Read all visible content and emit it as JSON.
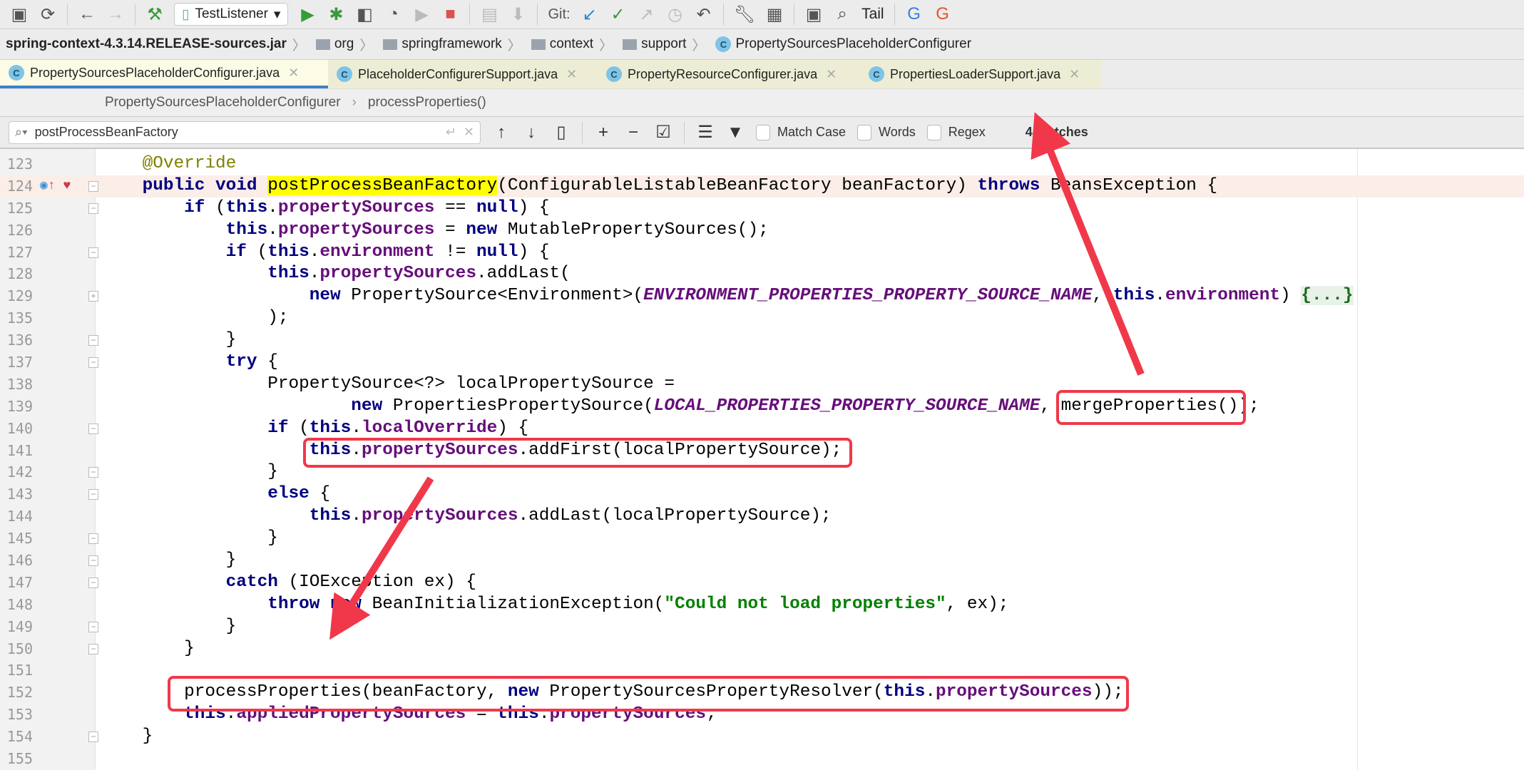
{
  "toolbar": {
    "run_config": "TestListener",
    "git_label": "Git:",
    "tail_label": "Tail"
  },
  "navbar": {
    "crumbs": [
      "spring-context-4.3.14.RELEASE-sources.jar",
      "org",
      "springframework",
      "context",
      "support",
      "PropertySourcesPlaceholderConfigurer"
    ]
  },
  "tabs": [
    {
      "label": "PropertySourcesPlaceholderConfigurer.java",
      "active": true
    },
    {
      "label": "PlaceholderConfigurerSupport.java"
    },
    {
      "label": "PropertyResourceConfigurer.java"
    },
    {
      "label": "PropertiesLoaderSupport.java"
    }
  ],
  "structure": {
    "class": "PropertySourcesPlaceholderConfigurer",
    "method": "processProperties()"
  },
  "search": {
    "value": "postProcessBeanFactory",
    "match_case": "Match Case",
    "words": "Words",
    "regex": "Regex",
    "matches": "4 matches"
  },
  "annotation_color": "#f0384a",
  "code": [
    {
      "n": "123",
      "i": 4,
      "t": [
        [
          "ann",
          "@Override"
        ]
      ]
    },
    {
      "n": "124",
      "i": 4,
      "hl": true,
      "fold": "-",
      "t": [
        [
          "kw",
          "public void "
        ],
        [
          "hly",
          "postProcessBeanFactory"
        ],
        [
          "",
          "(ConfigurableListableBeanFactory beanFactory) "
        ],
        [
          "kw",
          "throws"
        ],
        [
          "",
          " BeansException {"
        ]
      ]
    },
    {
      "n": "125",
      "i": 8,
      "fold": "-",
      "t": [
        [
          "kw",
          "if"
        ],
        [
          "",
          " ("
        ],
        [
          "kw",
          "this"
        ],
        [
          "",
          "."
        ],
        [
          "fld",
          "propertySources"
        ],
        [
          "",
          " == "
        ],
        [
          "kw",
          "null"
        ],
        [
          "",
          ") {"
        ]
      ]
    },
    {
      "n": "126",
      "i": 12,
      "t": [
        [
          "kw",
          "this"
        ],
        [
          "",
          "."
        ],
        [
          "fld",
          "propertySources"
        ],
        [
          "",
          " = "
        ],
        [
          "kw",
          "new"
        ],
        [
          "",
          " MutablePropertySources();"
        ]
      ]
    },
    {
      "n": "127",
      "i": 12,
      "fold": "-",
      "t": [
        [
          "kw",
          "if"
        ],
        [
          "",
          " ("
        ],
        [
          "kw",
          "this"
        ],
        [
          "",
          "."
        ],
        [
          "fld",
          "environment"
        ],
        [
          "",
          " != "
        ],
        [
          "kw",
          "null"
        ],
        [
          "",
          ") {"
        ]
      ]
    },
    {
      "n": "128",
      "i": 16,
      "t": [
        [
          "kw",
          "this"
        ],
        [
          "",
          "."
        ],
        [
          "fld",
          "propertySources"
        ],
        [
          "",
          ".addLast("
        ]
      ]
    },
    {
      "n": "129",
      "i": 20,
      "fold": "+",
      "t": [
        [
          "kw",
          "new"
        ],
        [
          "",
          " PropertySource<Environment>("
        ],
        [
          "cst",
          "ENVIRONMENT_PROPERTIES_PROPERTY_SOURCE_NAME"
        ],
        [
          "",
          ", "
        ],
        [
          "kw",
          "this"
        ],
        [
          "",
          "."
        ],
        [
          "fld",
          "environment"
        ],
        [
          "",
          ") "
        ],
        [
          "fd",
          "{...}"
        ]
      ]
    },
    {
      "n": "135",
      "i": 16,
      "t": [
        [
          "",
          ");"
        ]
      ]
    },
    {
      "n": "136",
      "i": 12,
      "fold": "-",
      "t": [
        [
          "",
          "}"
        ]
      ]
    },
    {
      "n": "137",
      "i": 12,
      "fold": "-",
      "t": [
        [
          "kw",
          "try"
        ],
        [
          "",
          " {"
        ]
      ]
    },
    {
      "n": "138",
      "i": 16,
      "t": [
        [
          "",
          "PropertySource<?> localPropertySource ="
        ]
      ]
    },
    {
      "n": "139",
      "i": 24,
      "t": [
        [
          "kw",
          "new"
        ],
        [
          "",
          " PropertiesPropertySource("
        ],
        [
          "cst",
          "LOCAL_PROPERTIES_PROPERTY_SOURCE_NAME"
        ],
        [
          "",
          ", mergeProperties());"
        ]
      ]
    },
    {
      "n": "140",
      "i": 16,
      "fold": "-",
      "t": [
        [
          "kw",
          "if"
        ],
        [
          "",
          " ("
        ],
        [
          "kw",
          "this"
        ],
        [
          "",
          "."
        ],
        [
          "fld",
          "localOverride"
        ],
        [
          "",
          ") {"
        ]
      ]
    },
    {
      "n": "141",
      "i": 20,
      "t": [
        [
          "kw",
          "this"
        ],
        [
          "",
          "."
        ],
        [
          "fld",
          "propertySources"
        ],
        [
          "",
          ".addFirst(localPropertySource);"
        ]
      ]
    },
    {
      "n": "142",
      "i": 16,
      "fold": "-",
      "t": [
        [
          "",
          "}"
        ]
      ]
    },
    {
      "n": "143",
      "i": 16,
      "fold": "-",
      "t": [
        [
          "kw",
          "else"
        ],
        [
          "",
          " {"
        ]
      ]
    },
    {
      "n": "144",
      "i": 20,
      "t": [
        [
          "kw",
          "this"
        ],
        [
          "",
          "."
        ],
        [
          "fld",
          "propertySources"
        ],
        [
          "",
          ".addLast(localPropertySource);"
        ]
      ]
    },
    {
      "n": "145",
      "i": 16,
      "fold": "-",
      "t": [
        [
          "",
          "}"
        ]
      ]
    },
    {
      "n": "146",
      "i": 12,
      "fold": "-",
      "t": [
        [
          "",
          "}"
        ]
      ]
    },
    {
      "n": "147",
      "i": 12,
      "fold": "-",
      "t": [
        [
          "kw",
          "catch"
        ],
        [
          "",
          " (IOException ex) {"
        ]
      ]
    },
    {
      "n": "148",
      "i": 16,
      "t": [
        [
          "kw",
          "throw"
        ],
        [
          "",
          " "
        ],
        [
          "kw",
          "new"
        ],
        [
          "",
          " BeanInitializationException("
        ],
        [
          "str",
          "\"Could not load properties\""
        ],
        [
          "",
          ", ex);"
        ]
      ]
    },
    {
      "n": "149",
      "i": 12,
      "fold": "-",
      "t": [
        [
          "",
          "}"
        ]
      ]
    },
    {
      "n": "150",
      "i": 8,
      "fold": "-",
      "t": [
        [
          "",
          "}"
        ]
      ]
    },
    {
      "n": "151",
      "i": 0,
      "t": []
    },
    {
      "n": "152",
      "i": 8,
      "t": [
        [
          "",
          "processProperties(beanFactory, "
        ],
        [
          "kw",
          "new"
        ],
        [
          "",
          " PropertySourcesPropertyResolver("
        ],
        [
          "kw",
          "this"
        ],
        [
          "",
          "."
        ],
        [
          "fld",
          "propertySources"
        ],
        [
          "",
          "));"
        ]
      ]
    },
    {
      "n": "153",
      "i": 8,
      "t": [
        [
          "kw",
          "this"
        ],
        [
          "",
          "."
        ],
        [
          "fld",
          "appliedPropertySources"
        ],
        [
          "",
          " = "
        ],
        [
          "kw",
          "this"
        ],
        [
          "",
          "."
        ],
        [
          "fld",
          "propertySources"
        ],
        [
          "",
          ";"
        ]
      ]
    },
    {
      "n": "154",
      "i": 4,
      "fold": "-",
      "t": [
        [
          "",
          "}"
        ]
      ]
    },
    {
      "n": "155",
      "i": 0,
      "t": []
    }
  ]
}
